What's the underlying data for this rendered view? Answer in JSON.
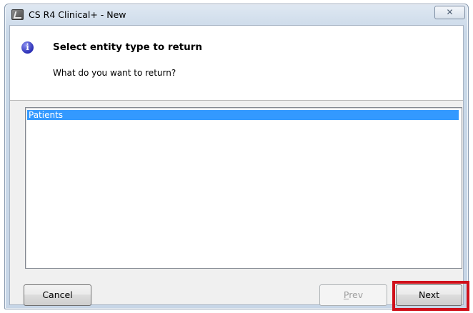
{
  "window": {
    "title": "CS R4 Clinical+ - New",
    "close_glyph": "⊠",
    "app_icon": "cs-r4-app-icon"
  },
  "header": {
    "icon": "info-icon",
    "title": "Select entity type to return",
    "subtitle": "What do you want to return?"
  },
  "list": {
    "items": [
      {
        "label": "Patients",
        "selected": true
      }
    ],
    "selected_color": "#3399ff"
  },
  "buttons": {
    "cancel": "Cancel",
    "prev": "Prev",
    "prev_enabled": false,
    "next": "Next"
  },
  "highlight_color": "#d0101a"
}
